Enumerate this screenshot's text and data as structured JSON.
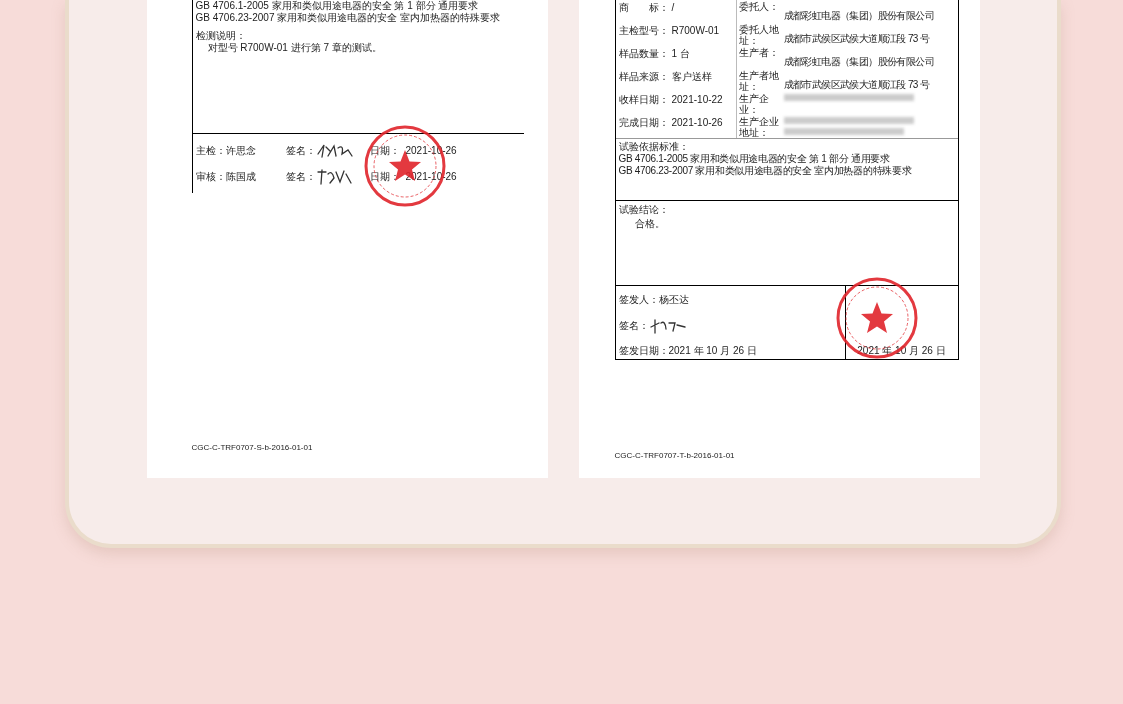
{
  "left_page": {
    "standards": [
      "GB 4706.1-2005 家用和类似用途电器的安全 第 1 部分 通用要求",
      "GB 4706.23-2007 家用和类似用途电器的安全 室内加热器的特殊要求"
    ],
    "notes_label": "检测说明：",
    "notes": "对型号 R700W-01 进行第 7 章的测试。",
    "signoffs": [
      {
        "role_label": "主检：",
        "person": "许思念",
        "sign_label": "签名：",
        "date_label": "日期：",
        "date": "2021-10-26"
      },
      {
        "role_label": "审核：",
        "person": "陈国成",
        "sign_label": "签名：",
        "date_label": "日期：",
        "date": "2021-10-26"
      }
    ],
    "form_code": "CGC-C-TRF0707-S-b-2016-01-01"
  },
  "right_page": {
    "info_rows": [
      {
        "label": "商　　标：",
        "value": "/",
        "label_2": "委托人：",
        "kind": "text",
        "value_2": "成都彩虹电器（集团）股份有限公司"
      },
      {
        "label": "主检型号：",
        "value": "R700W-01",
        "label_2": "委托人地址：",
        "kind": "text",
        "value_2": "成都市武侯区武侯大道顺江段 73 号"
      },
      {
        "label": "样品数量：",
        "value": "1 台",
        "label_2": "生产者：",
        "kind": "text",
        "value_2": "成都彩虹电器（集团）股份有限公司"
      },
      {
        "label": "样品来源：",
        "value": "客户送样",
        "label_2": "生产者地址：",
        "kind": "text",
        "value_2": "成都市武侯区武侯大道顺江段 73 号"
      },
      {
        "label": "收样日期：",
        "value": "2021-10-22",
        "label_2": "生产企业：",
        "kind": "blurred"
      },
      {
        "label": "完成日期：",
        "value": "2021-10-26",
        "label_2": "生产企业地址：",
        "kind": "blurred_wrapped"
      }
    ],
    "standards_label": "试验依据标准：",
    "standards": [
      "GB 4706.1-2005 家用和类似用途电器的安全 第 1 部分 通用要求",
      "GB 4706.23-2007 家用和类似用途电器的安全 室内加热器的特殊要求"
    ],
    "conclusion_label": "试验结论：",
    "conclusion": "合格。",
    "issuer_label": "签发人：",
    "issuer": "杨丕达",
    "sign_label": "签名：",
    "issue_date_label": "签发日期：",
    "issue_date": "2021 年 10 月 26 日",
    "stamp_date": "2021 年 10 月 26 日",
    "form_code": "CGC-C-TRF0707-T-b-2016-01-01"
  }
}
